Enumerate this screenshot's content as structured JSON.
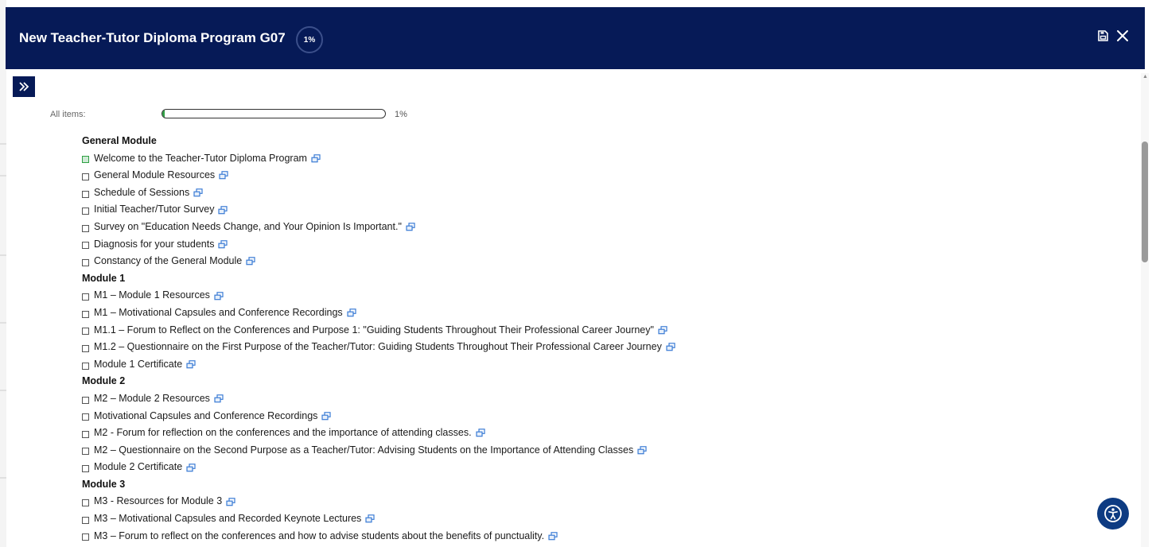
{
  "header": {
    "title": "New Teacher-Tutor Diploma Program G07",
    "progress_badge": "1%",
    "save_icon": "save-file-icon",
    "close_icon": "close-icon"
  },
  "sidebar_toggle": {
    "icon": "double-chevron-right-icon"
  },
  "overall_progress": {
    "label": "All items:",
    "value_text": "1%",
    "fraction": 0.01
  },
  "colors": {
    "header_bg": "#061a57",
    "progress_fill": "#2ea043",
    "link_icon": "#3a7bd5",
    "a11y_button": "#0d3b82"
  },
  "items": [
    {
      "type": "section",
      "label": "General Module"
    },
    {
      "type": "item",
      "label": "Welcome to the Teacher-Tutor Diploma Program",
      "completed": true
    },
    {
      "type": "item",
      "label": "General Module Resources",
      "completed": false
    },
    {
      "type": "item",
      "label": "Schedule of Sessions",
      "completed": false
    },
    {
      "type": "item",
      "label": "Initial Teacher/Tutor Survey",
      "completed": false
    },
    {
      "type": "item",
      "label": "Survey on \"Education Needs Change, and Your Opinion Is Important.\"",
      "completed": false
    },
    {
      "type": "item",
      "label": "Diagnosis for your students",
      "completed": false
    },
    {
      "type": "item",
      "label": "Constancy of the General Module",
      "completed": false
    },
    {
      "type": "section",
      "label": "Module 1"
    },
    {
      "type": "item",
      "label": "M1 – Module 1 Resources",
      "completed": false
    },
    {
      "type": "item",
      "label": "M1 – Motivational Capsules and Conference Recordings",
      "completed": false
    },
    {
      "type": "item",
      "label": "M1.1 – Forum to Reflect on the Conferences and Purpose 1: \"Guiding Students Throughout Their Professional Career Journey\"",
      "completed": false
    },
    {
      "type": "item",
      "label": "M1.2 – Questionnaire on the First Purpose of the Teacher/Tutor: Guiding Students Throughout Their Professional Career Journey",
      "completed": false
    },
    {
      "type": "item",
      "label": "Module 1 Certificate",
      "completed": false
    },
    {
      "type": "section",
      "label": "Module 2"
    },
    {
      "type": "item",
      "label": "M2 – Module 2 Resources",
      "completed": false
    },
    {
      "type": "item",
      "label": "Motivational Capsules and Conference Recordings",
      "completed": false
    },
    {
      "type": "item",
      "label": "M2 - Forum for reflection on the conferences and the importance of attending classes.",
      "completed": false
    },
    {
      "type": "item",
      "label": "M2 – Questionnaire on the Second Purpose as a Teacher/Tutor: Advising Students on the Importance of Attending Classes",
      "completed": false
    },
    {
      "type": "item",
      "label": "Module 2 Certificate",
      "completed": false
    },
    {
      "type": "section",
      "label": "Module 3"
    },
    {
      "type": "item",
      "label": "M3 - Resources for Module 3",
      "completed": false
    },
    {
      "type": "item",
      "label": "M3 – Motivational Capsules and Recorded Keynote Lectures",
      "completed": false
    },
    {
      "type": "item",
      "label": "M3 – Forum to reflect on the conferences and how to advise students about the benefits of punctuality.",
      "completed": false
    }
  ],
  "accessibility_button": {
    "icon": "accessibility-icon"
  }
}
